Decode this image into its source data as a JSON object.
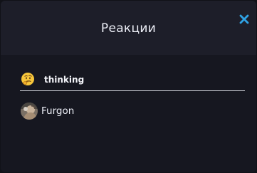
{
  "dialog": {
    "title": "Реакции",
    "close_icon": "close-icon",
    "accent_color": "#2fa3e6"
  },
  "reaction_tabs": [
    {
      "emoji_icon": "thinking-face-emoji",
      "label": "thinking",
      "selected": true
    }
  ],
  "users": [
    {
      "avatar_icon": "user-avatar",
      "name": "Furgon"
    }
  ]
}
